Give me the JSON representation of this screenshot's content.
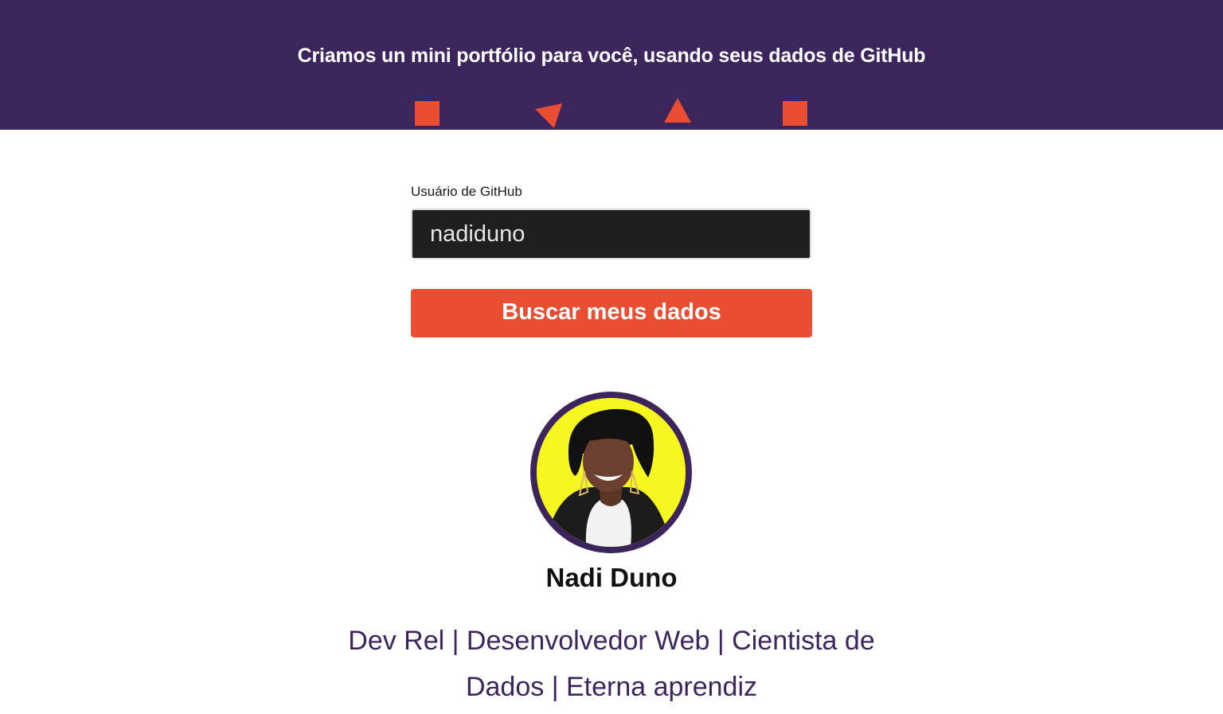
{
  "header": {
    "title": "Criamos un mini portfólio para você, usando seus dados de GitHub",
    "accent_color": "#e94e33",
    "background_color": "#3c245c",
    "decorations": [
      "square-shape",
      "triangle-shape",
      "triangle-shape",
      "square-shape"
    ]
  },
  "form": {
    "label": "Usuário de GitHub",
    "input_value": "nadiduno",
    "button_label": "Buscar meus dados"
  },
  "profile": {
    "avatar": "avatar-photo",
    "name": "Nadi Duno",
    "bio": "Dev Rel | Desenvolvedor Web | Cientista de Dados | Eterna aprendiz"
  }
}
